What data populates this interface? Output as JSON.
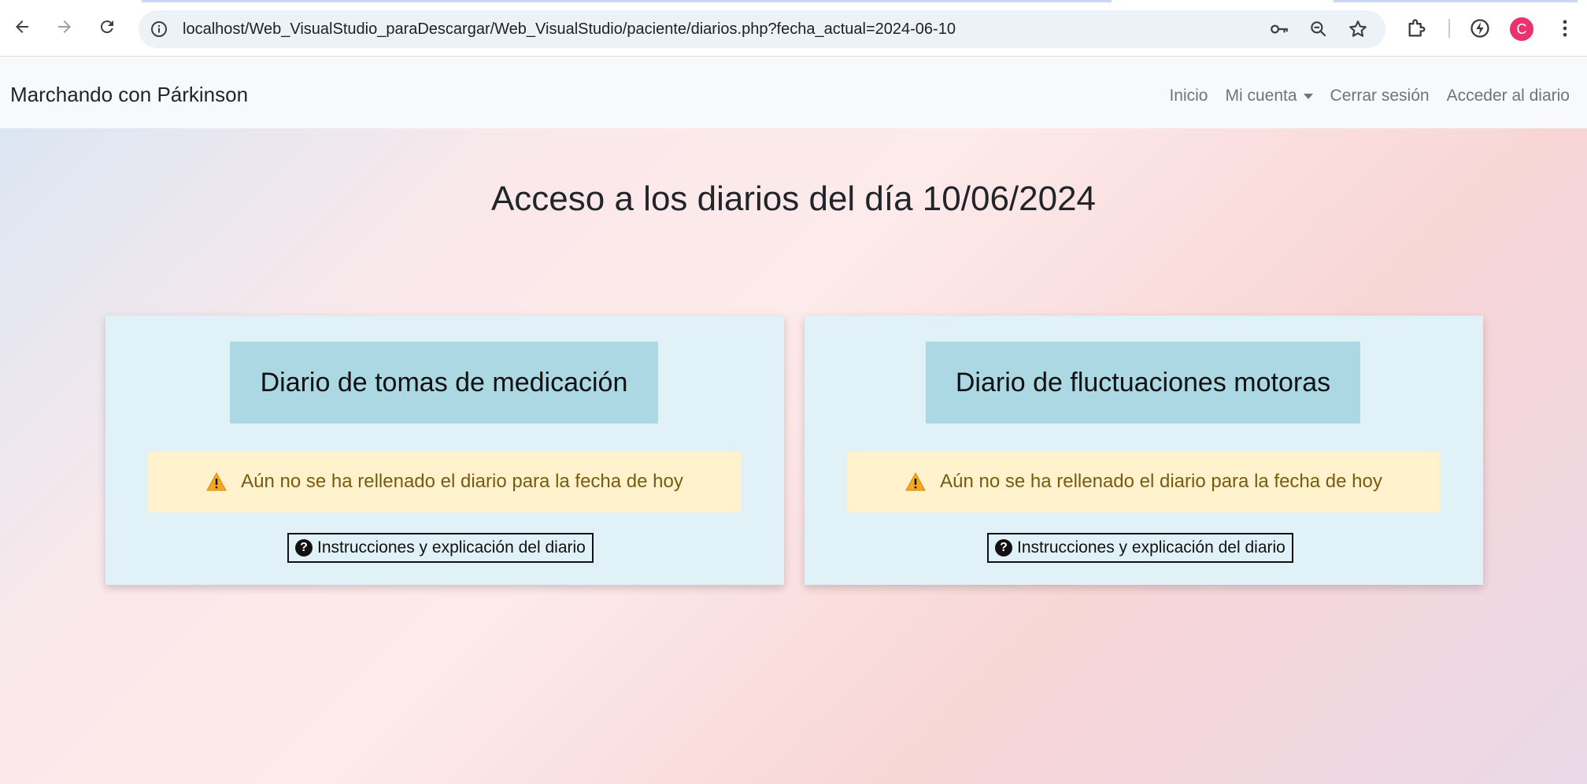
{
  "browser": {
    "url": "localhost/Web_VisualStudio_paraDescargar/Web_VisualStudio/paciente/diarios.php?fecha_actual=2024-06-10",
    "profile_initial": "C",
    "icons": [
      "back-icon",
      "forward-icon",
      "reload-icon",
      "site-info-icon",
      "password-key-icon",
      "zoom-icon",
      "bookmark-star-icon",
      "extensions-icon",
      "performance-icon",
      "menu-icon"
    ]
  },
  "navbar": {
    "brand": "Marchando con Párkinson",
    "links": [
      "Inicio",
      "Mi cuenta",
      "Cerrar sesión",
      "Acceder al diario"
    ]
  },
  "main": {
    "heading": "Acceso a los diarios del día 10/06/2024",
    "cards": [
      {
        "title": "Diario de tomas de medicación",
        "alert": "Aún no se ha rellenado el diario para la fecha de hoy",
        "instructions": "Instrucciones y explicación del diario"
      },
      {
        "title": "Diario de fluctuaciones motoras",
        "alert": "Aún no se ha rellenado el diario para la fecha de hoy",
        "instructions": "Instrucciones y explicación del diario"
      }
    ]
  },
  "colors": {
    "card_bg": "#e0f1f8",
    "card_title_bg": "#acd8e4",
    "alert_bg": "#fff2cc",
    "alert_text": "#7a5a10",
    "profile": "#e8336e"
  }
}
